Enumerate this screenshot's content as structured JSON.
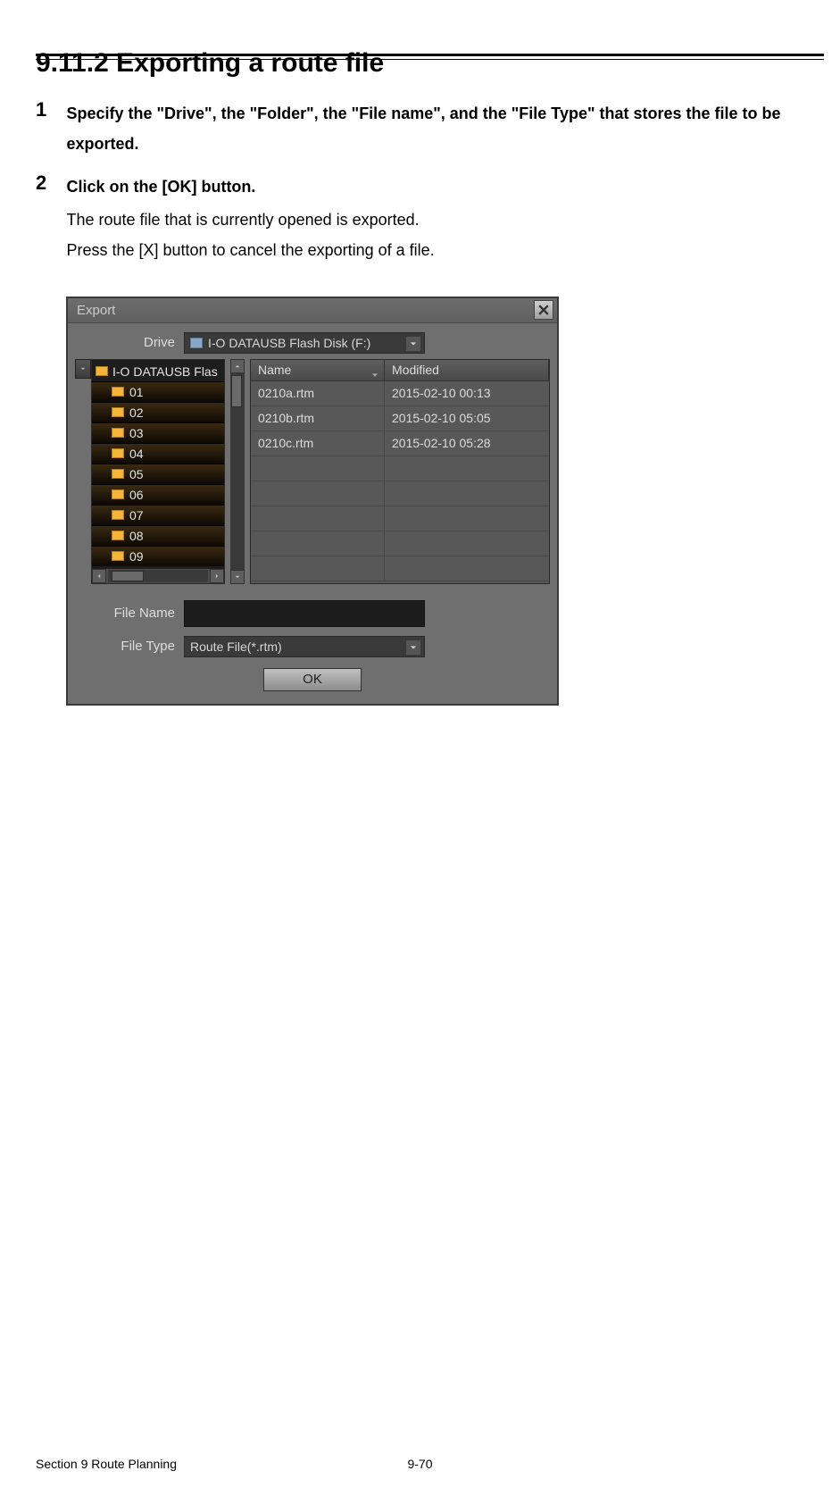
{
  "page": {
    "heading_num": "9.11.2",
    "heading_text": "Exporting a route file",
    "steps": [
      {
        "num": "1",
        "bold": "Specify the \"Drive\", the \"Folder\", the \"File name\", and the \"File Type\" that stores the file to be exported."
      },
      {
        "num": "2",
        "bold": "Click on the [OK] button.",
        "plain1": "The route file that is currently opened is exported.",
        "plain2": "Press the [X] button to cancel the exporting of a file."
      }
    ],
    "footer_left": "Section 9    Route Planning",
    "footer_center": "9-70"
  },
  "dialog": {
    "title": "Export",
    "labels": {
      "drive": "Drive",
      "file_name": "File Name",
      "file_type": "File Type"
    },
    "drive_selected": "I-O DATAUSB Flash Disk (F:)",
    "tree": {
      "root": "I-O DATAUSB Flas",
      "folders": [
        "01",
        "02",
        "03",
        "04",
        "05",
        "06",
        "07",
        "08",
        "09"
      ]
    },
    "columns": {
      "name": "Name",
      "modified": "Modified"
    },
    "files": [
      {
        "name": "0210a.rtm",
        "modified": "2015-02-10 00:13"
      },
      {
        "name": "0210b.rtm",
        "modified": "2015-02-10 05:05"
      },
      {
        "name": "0210c.rtm",
        "modified": "2015-02-10 05:28"
      }
    ],
    "file_name_value": "",
    "file_type_selected": "Route File(*.rtm)",
    "ok_label": "OK"
  }
}
